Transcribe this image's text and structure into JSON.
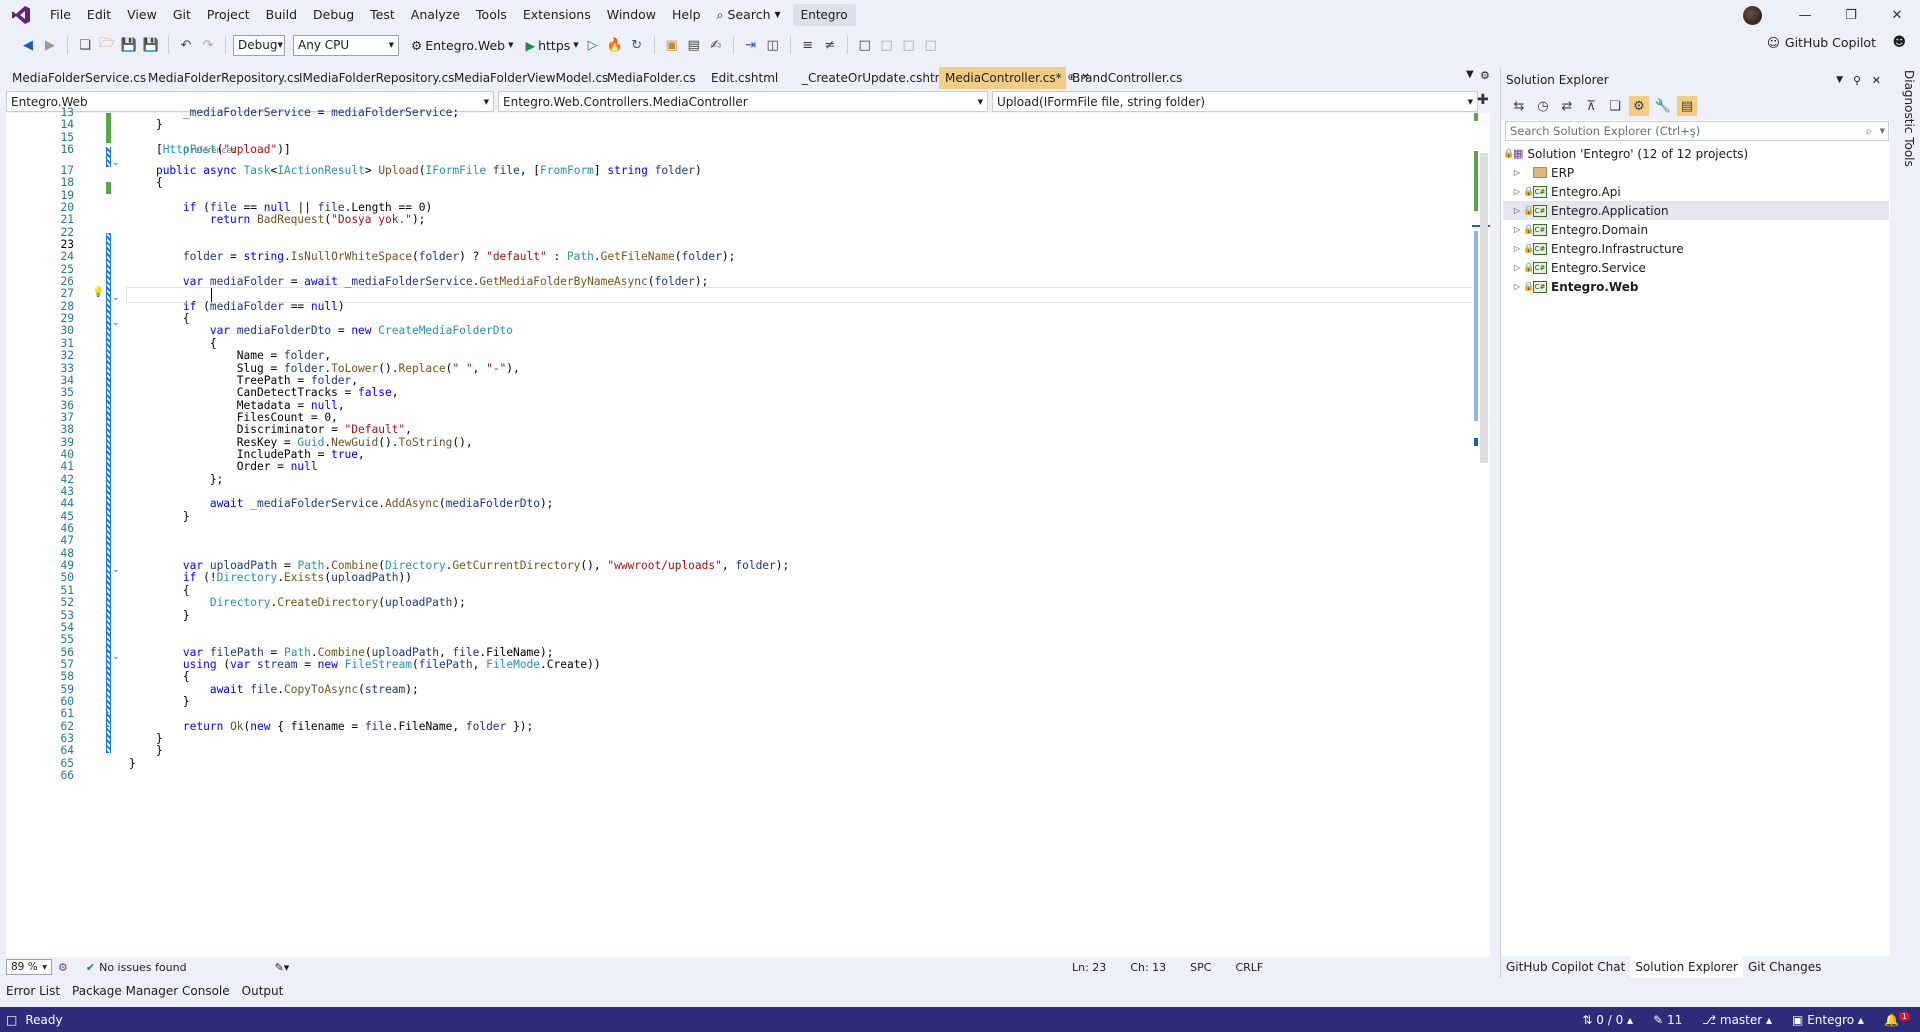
{
  "menu": [
    "File",
    "Edit",
    "View",
    "Git",
    "Project",
    "Build",
    "Debug",
    "Test",
    "Analyze",
    "Tools",
    "Extensions",
    "Window",
    "Help"
  ],
  "search_label": "Search",
  "solution_badge": "Entegro",
  "toolbar": {
    "config": "Debug",
    "platform": "Any CPU",
    "startup_project": "Entegro.Web",
    "launch_profile": "https",
    "copilot": "GitHub Copilot"
  },
  "doc_tabs": [
    {
      "label": "MediaFolderService.cs",
      "active": false
    },
    {
      "label": "MediaFolderRepository.cs",
      "active": false
    },
    {
      "label": "IMediaFolderRepository.cs",
      "active": false
    },
    {
      "label": "MediaFolderViewModel.cs",
      "active": false
    },
    {
      "label": "MediaFolder.cs",
      "active": false
    },
    {
      "label": "Edit.cshtml",
      "active": false
    },
    {
      "label": "_CreateOrUpdate.cshtml",
      "active": false
    },
    {
      "label": "MediaController.cs*",
      "active": true
    },
    {
      "label": "BrandController.cs",
      "active": false
    }
  ],
  "navbar": {
    "project": "Entegro.Web",
    "type": "Entegro.Web.Controllers.MediaController",
    "member": "Upload(IFormFile file, string folder)"
  },
  "code": {
    "line_numbers": [
      "13",
      "14",
      "15",
      "16",
      "17",
      "18",
      "19",
      "20",
      "21",
      "22",
      "23",
      "24",
      "25",
      "26",
      "27",
      "28",
      "29",
      "30",
      "31",
      "32",
      "33",
      "34",
      "35",
      "36",
      "37",
      "38",
      "39",
      "40",
      "41",
      "42",
      "43",
      "44",
      "45",
      "46",
      "47",
      "48",
      "49",
      "50",
      "51",
      "52",
      "53",
      "54",
      "55",
      "56",
      "57",
      "58",
      "59",
      "60",
      "61",
      "62",
      "63",
      "64",
      "65",
      "66"
    ],
    "current_line": "23",
    "references_label": "0 references"
  },
  "editor_status": {
    "zoom": "89 %",
    "issues": "No issues found",
    "line": "Ln: 23",
    "col": "Ch: 13",
    "whitespace": "SPC",
    "line_ending": "CRLF"
  },
  "bottom_tabs": [
    "Error List",
    "Package Manager Console",
    "Output"
  ],
  "statusbar": {
    "ready": "Ready",
    "sync": "0 / 0",
    "changes": "11",
    "branch": "master",
    "repo": "Entegro",
    "notifications": "1"
  },
  "solution_explorer": {
    "title": "Solution Explorer",
    "search_placeholder": "Search Solution Explorer (Ctrl+ş)",
    "solution": "Solution 'Entegro' (12 of 12 projects)",
    "items": [
      {
        "label": "ERP",
        "kind": "folder",
        "bold": false,
        "highlight": false
      },
      {
        "label": "Entegro.Api",
        "kind": "project",
        "bold": false,
        "highlight": false
      },
      {
        "label": "Entegro.Application",
        "kind": "project",
        "bold": false,
        "highlight": true
      },
      {
        "label": "Entegro.Domain",
        "kind": "project",
        "bold": false,
        "highlight": false
      },
      {
        "label": "Entegro.Infrastructure",
        "kind": "project",
        "bold": false,
        "highlight": false
      },
      {
        "label": "Entegro.Service",
        "kind": "project",
        "bold": false,
        "highlight": false
      },
      {
        "label": "Entegro.Web",
        "kind": "web",
        "bold": true,
        "highlight": false
      }
    ],
    "bottom_tabs": [
      {
        "label": "GitHub Copilot Chat",
        "active": false
      },
      {
        "label": "Solution Explorer",
        "active": true
      },
      {
        "label": "Git Changes",
        "active": false
      }
    ]
  },
  "diagnostic_tools": "Diagnostic Tools",
  "colors": {
    "accent": "#68217a",
    "active_tab": "#f5cc84",
    "statusbar": "#2c2c7a"
  }
}
